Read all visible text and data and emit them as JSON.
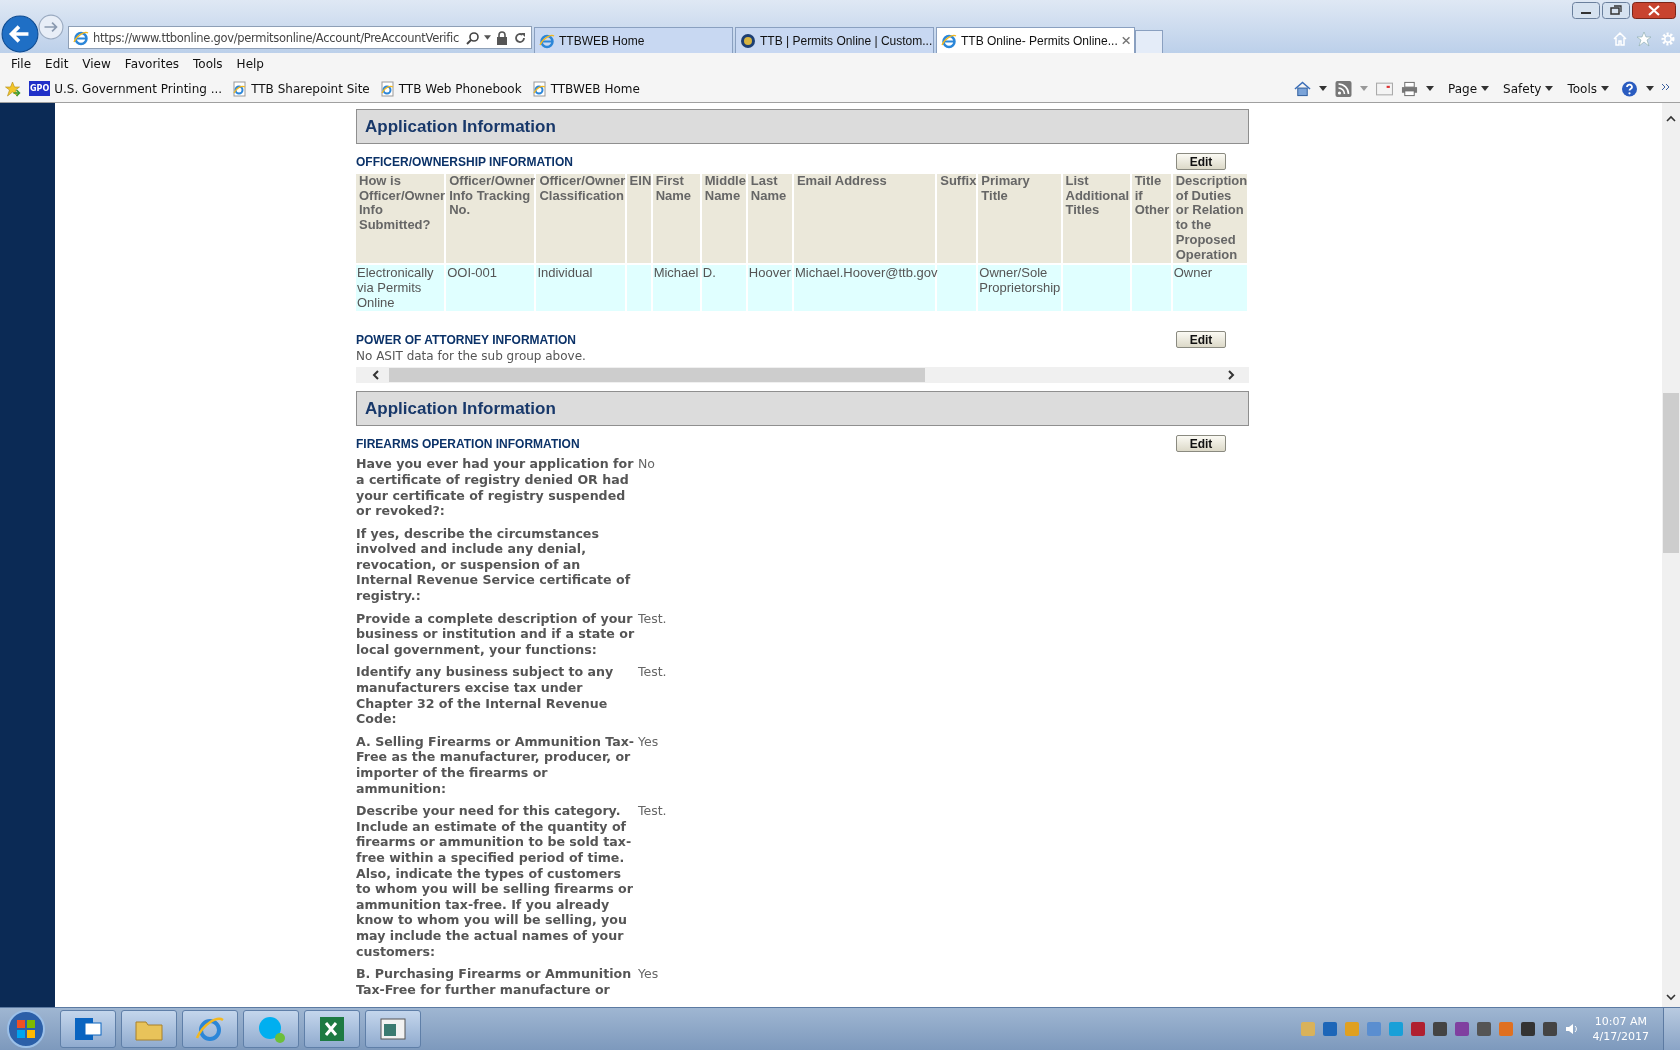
{
  "browser": {
    "address": "https://www.ttbonline.gov/permitsonline/Account/PreAccountVerific",
    "tabs": [
      {
        "label": "TTBWEB Home",
        "selected": false,
        "kind": "ie"
      },
      {
        "label": "TTB | Permits Online | Custom...",
        "selected": false,
        "kind": "seal"
      },
      {
        "label": "TTB Online- Permits Online...",
        "selected": true,
        "kind": "ie"
      }
    ],
    "menu": [
      "File",
      "Edit",
      "View",
      "Favorites",
      "Tools",
      "Help"
    ],
    "favorites": [
      {
        "label": "U.S. Government Printing ...",
        "badge": "GPO"
      },
      {
        "label": "TTB Sharepoint Site"
      },
      {
        "label": "TTB Web Phonebook"
      },
      {
        "label": "TTBWEB Home"
      }
    ],
    "command_bar": [
      "Page",
      "Safety",
      "Tools"
    ]
  },
  "sections": [
    {
      "title": "Application Information",
      "scrollbar": true,
      "groups": [
        {
          "kind": "table",
          "title": "OFFICER/OWNERSHIP INFORMATION",
          "button": "Edit",
          "table": {
            "columns": [
              "How is Officer/Owner Info Submitted?",
              "Officer/Owner Info Tracking No.",
              "Officer/Owner Classification",
              "EIN",
              "First Name",
              "Middle Name",
              "Last Name",
              "Email Address",
              "Suffix",
              "Primary Title",
              "List Additional Titles",
              "Title if Other",
              "Description of Duties or Relation to the Proposed Operation"
            ],
            "rows": [
              {
                "cells": [
                  "Electronically via Permits Online",
                  "OOI-001",
                  "Individual",
                  null,
                  "Michael",
                  "D.",
                  "Hoover",
                  "Michael.Hoover@ttb.gov",
                  null,
                  "Owner/Sole Proprietorship",
                  null,
                  null,
                  "Owner"
                ]
              }
            ]
          }
        },
        {
          "kind": "empty",
          "title": "POWER OF ATTORNEY INFORMATION",
          "button": "Edit",
          "message": "No ASIT data for the sub group above."
        }
      ]
    },
    {
      "title": "Application Information",
      "scrollbar": false,
      "groups": [
        {
          "kind": "qa",
          "title": "FIREARMS OPERATION INFORMATION",
          "button": "Edit",
          "items": [
            {
              "question": "Have you ever had your application for a certificate of registry denied OR had your certificate of registry suspended or revoked?:",
              "answer": "No"
            },
            {
              "question": "If yes, describe the circumstances involved and include any denial, revocation, or suspension of an Internal Revenue Service certificate of registry.:"
            },
            {
              "question": "Provide a complete description of your business or institution and if a state or local government, your functions:",
              "answer": "Test."
            },
            {
              "question": "Identify any business subject to any manufacturers excise tax under Chapter 32 of the Internal Revenue Code:",
              "answer": "Test."
            },
            {
              "question": "A. Selling Firearms or Ammunition Tax-Free as the manufacturer, producer, or importer of the firearms or ammunition:",
              "answer": "Yes"
            },
            {
              "question": "Describe your need for this category. Include an estimate of the quantity of firearms or ammunition to be sold tax-free within a specified period of time. Also, indicate the types of customers to whom you will be selling firearms or ammunition tax-free. If you already know to whom you will be selling, you may include the actual names of your customers:",
              "answer": "Test."
            },
            {
              "question": "B. Purchasing Firearms or Ammunition Tax-Free for further manufacture or",
              "answer": "Yes"
            }
          ]
        }
      ]
    }
  ],
  "taskbar": {
    "time": "10:07 AM",
    "date": "4/17/2017"
  }
}
